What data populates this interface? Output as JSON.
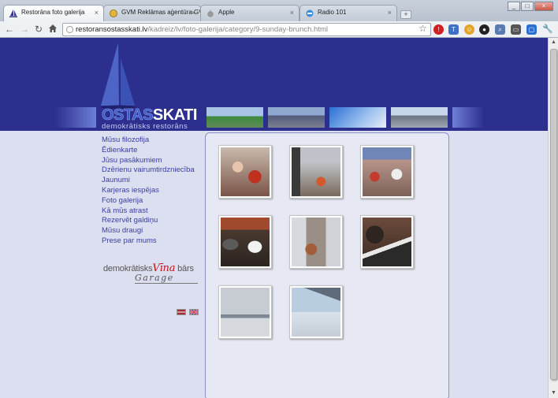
{
  "browser": {
    "tabs": [
      {
        "title": "Restorāna foto galerija",
        "active": true
      },
      {
        "title": "GVM Reklāmas aģentūra GVM",
        "active": false
      },
      {
        "title": "Apple",
        "active": false
      },
      {
        "title": "Radio 101",
        "active": false
      }
    ],
    "new_tab_label": "+",
    "window_controls": [
      "_",
      "□",
      "×"
    ],
    "url_host": "restoransostasskati.lv",
    "url_path": "/kadreiz/lv/foto-galerija/category/9-sunday-brunch.html"
  },
  "site": {
    "brand_part1": "OSTAS",
    "brand_part2": "SKATI",
    "tagline": "demokrātisks restorāns",
    "nav": [
      "Mūsu filozofija",
      "Ēdienkarte",
      "Jūsu pasākumiem",
      "Dzērienu vairumtirdzniecība",
      "Jaunumi",
      "Karjeras iespējas",
      "Foto galerija",
      "Kā mūs atrast",
      "Rezervēt galdiņu",
      "Mūsu draugi",
      "Prese par mums"
    ],
    "promo_pre": "demokrātisks",
    "promo_vina": "Vīna",
    "promo_post": "bārs",
    "promo_garage": "Garage"
  },
  "gallery": {
    "photos": [
      {
        "name": "brunch-photo-1",
        "tone": "#8a5a4a"
      },
      {
        "name": "brunch-photo-2",
        "tone": "#6e5f52"
      },
      {
        "name": "brunch-photo-3",
        "tone": "#8c6f66"
      },
      {
        "name": "brunch-photo-4",
        "tone": "#5a4438"
      },
      {
        "name": "brunch-photo-5",
        "tone": "#6b625a"
      },
      {
        "name": "brunch-photo-6",
        "tone": "#4e3b30"
      },
      {
        "name": "brunch-photo-7",
        "tone": "#b9bec6"
      },
      {
        "name": "brunch-photo-8",
        "tone": "#aeb8c4"
      }
    ]
  },
  "colors": {
    "header_bg": "#2c2f8e",
    "page_bg": "#dcdff0",
    "link": "#3a3fa0",
    "vina_red": "#c0121b"
  }
}
